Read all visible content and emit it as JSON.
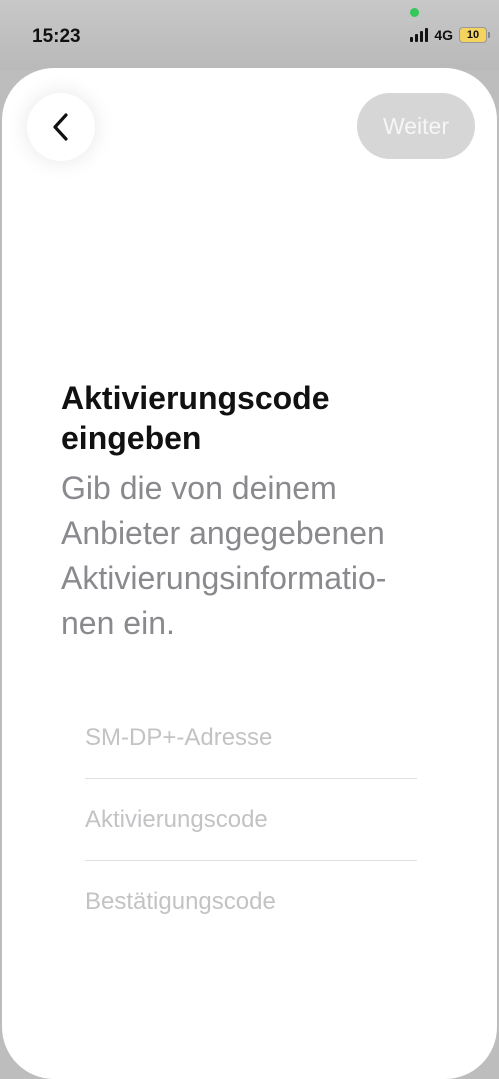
{
  "status_bar": {
    "time": "15:23",
    "network": "4G",
    "battery": "10"
  },
  "nav": {
    "back_icon": "chevron-left-icon",
    "next_label": "Weiter"
  },
  "content": {
    "title": "Aktivierungscode eingeben",
    "subtitle": "Gib die von deinem Anbieter angegebenen Aktivierungsinformatio-nen ein."
  },
  "fields": {
    "smdp_placeholder": "SM-DP+-Adresse",
    "activation_placeholder": "Aktivierungscode",
    "confirmation_placeholder": "Bestätigungscode"
  }
}
